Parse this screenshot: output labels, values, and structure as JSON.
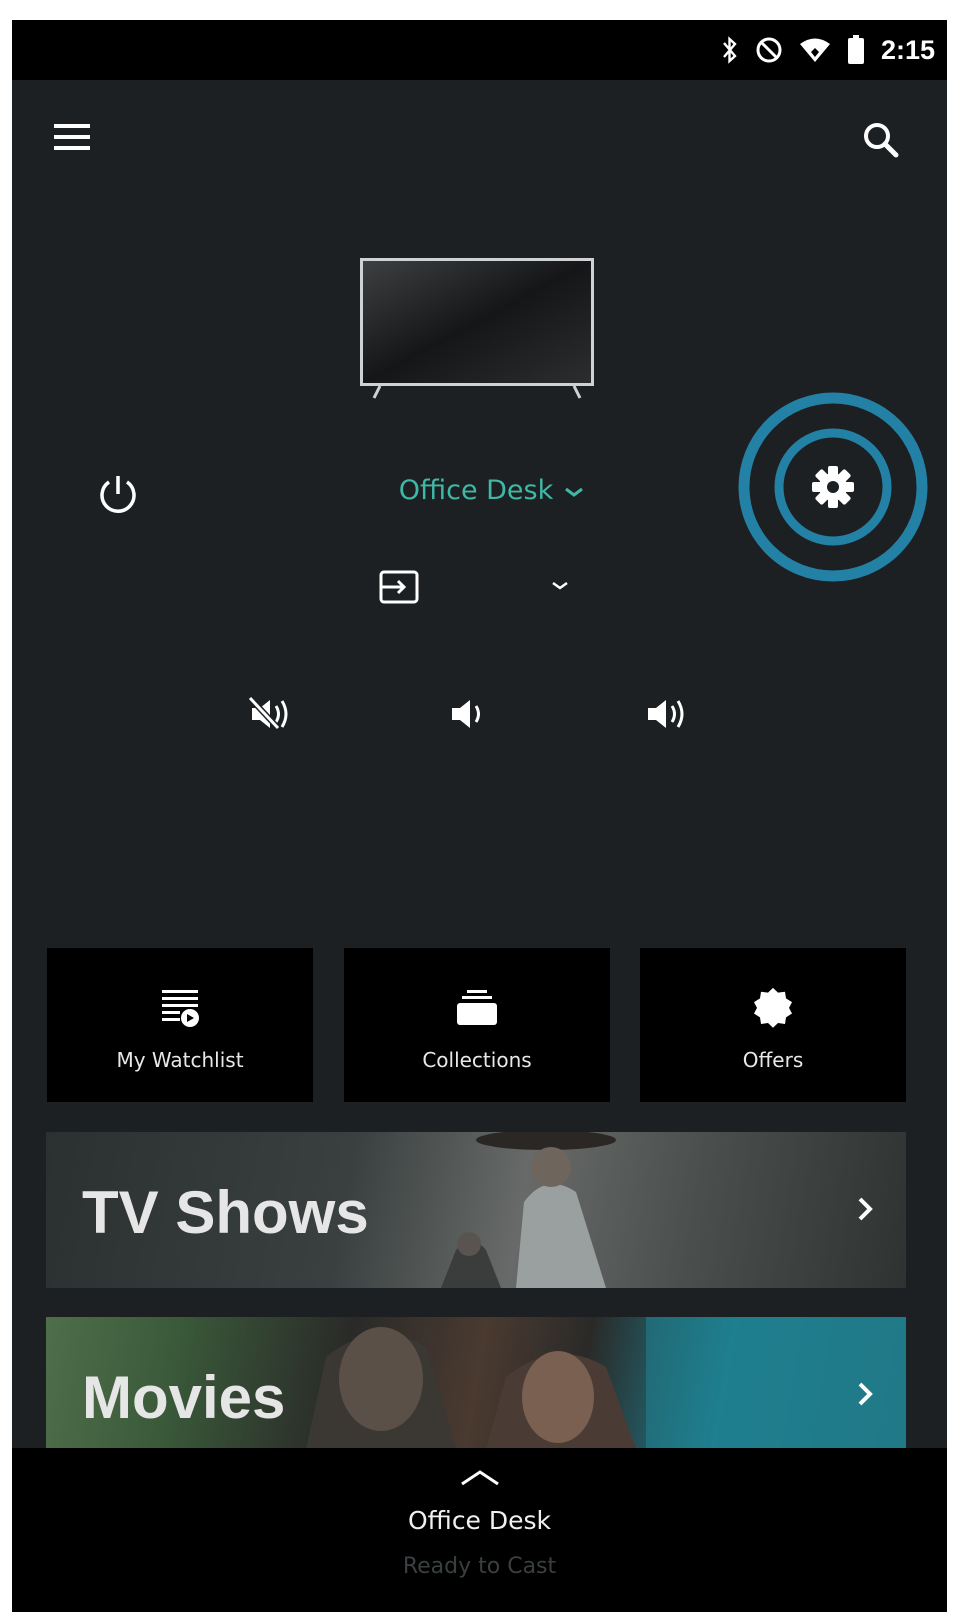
{
  "status_bar": {
    "time": "2:15",
    "icons": [
      "bluetooth-icon",
      "do-not-disturb-icon",
      "wifi-icon",
      "battery-icon"
    ]
  },
  "app_bar": {
    "left_icon": "menu-icon",
    "right_icon": "search-icon"
  },
  "device": {
    "name": "Office Desk",
    "name_color": "#3fb8a6",
    "highlight_ring_color": "#2481a6"
  },
  "tiles": [
    {
      "label": "My Watchlist",
      "icon": "watchlist-icon"
    },
    {
      "label": "Collections",
      "icon": "collections-icon"
    },
    {
      "label": "Offers",
      "icon": "offers-badge-icon"
    }
  ],
  "banners": [
    {
      "title": "TV Shows"
    },
    {
      "title": "Movies"
    }
  ],
  "bottom_bar": {
    "title": "Office Desk",
    "subtitle": "Ready to Cast"
  }
}
